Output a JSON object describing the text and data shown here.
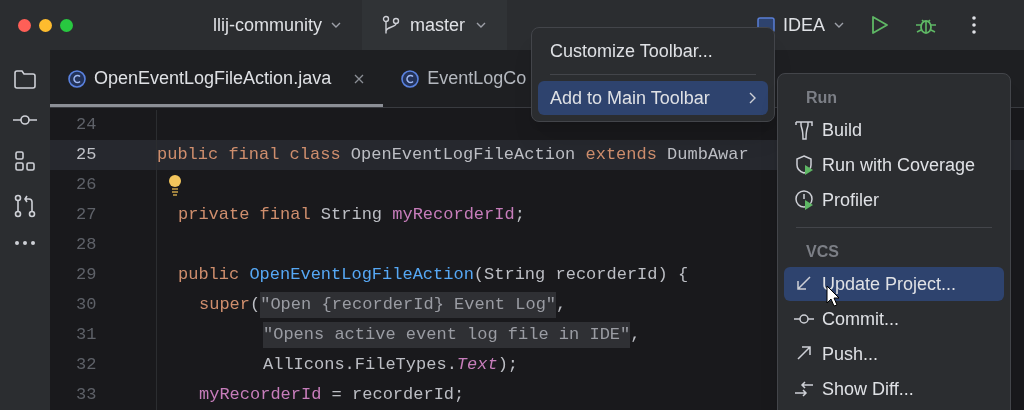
{
  "title_bar": {
    "project": "llij-community",
    "branch": "master",
    "run_config": "IDEA"
  },
  "tabs": [
    {
      "label": "OpenEventLogFileAction.java",
      "selected": true
    },
    {
      "label": "EventLogCo",
      "selected": false
    }
  ],
  "editor": {
    "lines": [
      {
        "number": "24",
        "current": false
      },
      {
        "number": "25",
        "current": true,
        "tokens": [
          {
            "kind": "kw",
            "text": "public final class "
          },
          {
            "kind": "plain",
            "text": "OpenEventLogFileAction "
          },
          {
            "kind": "kw",
            "text": "extends "
          },
          {
            "kind": "plain",
            "text": "DumbAwar"
          }
        ]
      },
      {
        "number": "26",
        "current": false,
        "bulb": true
      },
      {
        "number": "27",
        "current": false,
        "tokens": [
          {
            "kind": "kw",
            "text": "private final "
          },
          {
            "kind": "plain",
            "text": "String "
          },
          {
            "kind": "field",
            "text": "myRecorderId"
          },
          {
            "kind": "plain",
            "text": ";"
          }
        ]
      },
      {
        "number": "28",
        "current": false
      },
      {
        "number": "29",
        "current": false,
        "tokens": [
          {
            "kind": "kw",
            "text": "public "
          },
          {
            "kind": "fn",
            "text": "OpenEventLogFileAction"
          },
          {
            "kind": "plain",
            "text": "(String recorderId) {"
          }
        ]
      },
      {
        "number": "30",
        "current": false,
        "tokens": [
          {
            "kind": "kw",
            "text": "super"
          },
          {
            "kind": "plain",
            "text": "("
          },
          {
            "kind": "str",
            "text": "\"Open {recorderId} Event Log\""
          },
          {
            "kind": "plain",
            "text": ","
          }
        ]
      },
      {
        "number": "31",
        "current": false,
        "tokens": [
          {
            "kind": "str",
            "text": "\"Opens active event log file in IDE\""
          },
          {
            "kind": "plain",
            "text": ","
          }
        ]
      },
      {
        "number": "32",
        "current": false,
        "tokens": [
          {
            "kind": "plain",
            "text": "AllIcons.FileTypes."
          },
          {
            "kind": "ital",
            "text": "Text"
          },
          {
            "kind": "plain",
            "text": ");"
          }
        ]
      },
      {
        "number": "33",
        "current": false,
        "tokens": [
          {
            "kind": "field",
            "text": "myRecorderId"
          },
          {
            "kind": "plain",
            "text": " = recorderId;"
          }
        ]
      }
    ]
  },
  "context_menu": [
    {
      "kind": "item",
      "label": "Customize Toolbar...",
      "selected": false
    },
    {
      "kind": "separator"
    },
    {
      "kind": "submenu",
      "label": "Add to Main Toolbar",
      "selected": true
    }
  ],
  "submenu": [
    {
      "kind": "header",
      "label": "Run"
    },
    {
      "kind": "item",
      "label": "Build",
      "selected": false
    },
    {
      "kind": "item",
      "label": "Run with Coverage",
      "selected": false
    },
    {
      "kind": "item",
      "label": "Profiler",
      "selected": false
    },
    {
      "kind": "separator"
    },
    {
      "kind": "header",
      "label": "VCS"
    },
    {
      "kind": "item",
      "label": "Update Project...",
      "selected": true
    },
    {
      "kind": "item",
      "label": "Commit...",
      "selected": false
    },
    {
      "kind": "item",
      "label": "Push...",
      "selected": false
    },
    {
      "kind": "item",
      "label": "Show Diff...",
      "selected": false
    }
  ]
}
